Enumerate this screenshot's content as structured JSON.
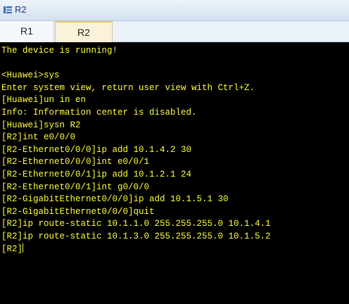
{
  "window": {
    "title": "R2",
    "icon": "network-device-icon"
  },
  "tabs": [
    {
      "label": "R1",
      "active": false
    },
    {
      "label": "R2",
      "active": true
    }
  ],
  "terminal": {
    "text_color": "#ffff3a",
    "background": "#000000",
    "lines": [
      "The device is running!",
      "",
      "<Huawei>sys",
      "Enter system view, return user view with Ctrl+Z.",
      "[Huawei]un in en",
      "Info: Information center is disabled.",
      "[Huawei]sysn R2",
      "[R2]int e0/0/0",
      "[R2-Ethernet0/0/0]ip add 10.1.4.2 30",
      "[R2-Ethernet0/0/0]int e0/0/1",
      "[R2-Ethernet0/0/1]ip add 10.1.2.1 24",
      "[R2-Ethernet0/0/1]int g0/0/0",
      "[R2-GigabitEthernet0/0/0]ip add 10.1.5.1 30",
      "[R2-GigabitEthernet0/0/0]quit",
      "[R2]ip route-static 10.1.1.0 255.255.255.0 10.1.4.1",
      "[R2]ip route-static 10.1.3.0 255.255.255.0 10.1.5.2"
    ],
    "prompt": "[R2]"
  }
}
